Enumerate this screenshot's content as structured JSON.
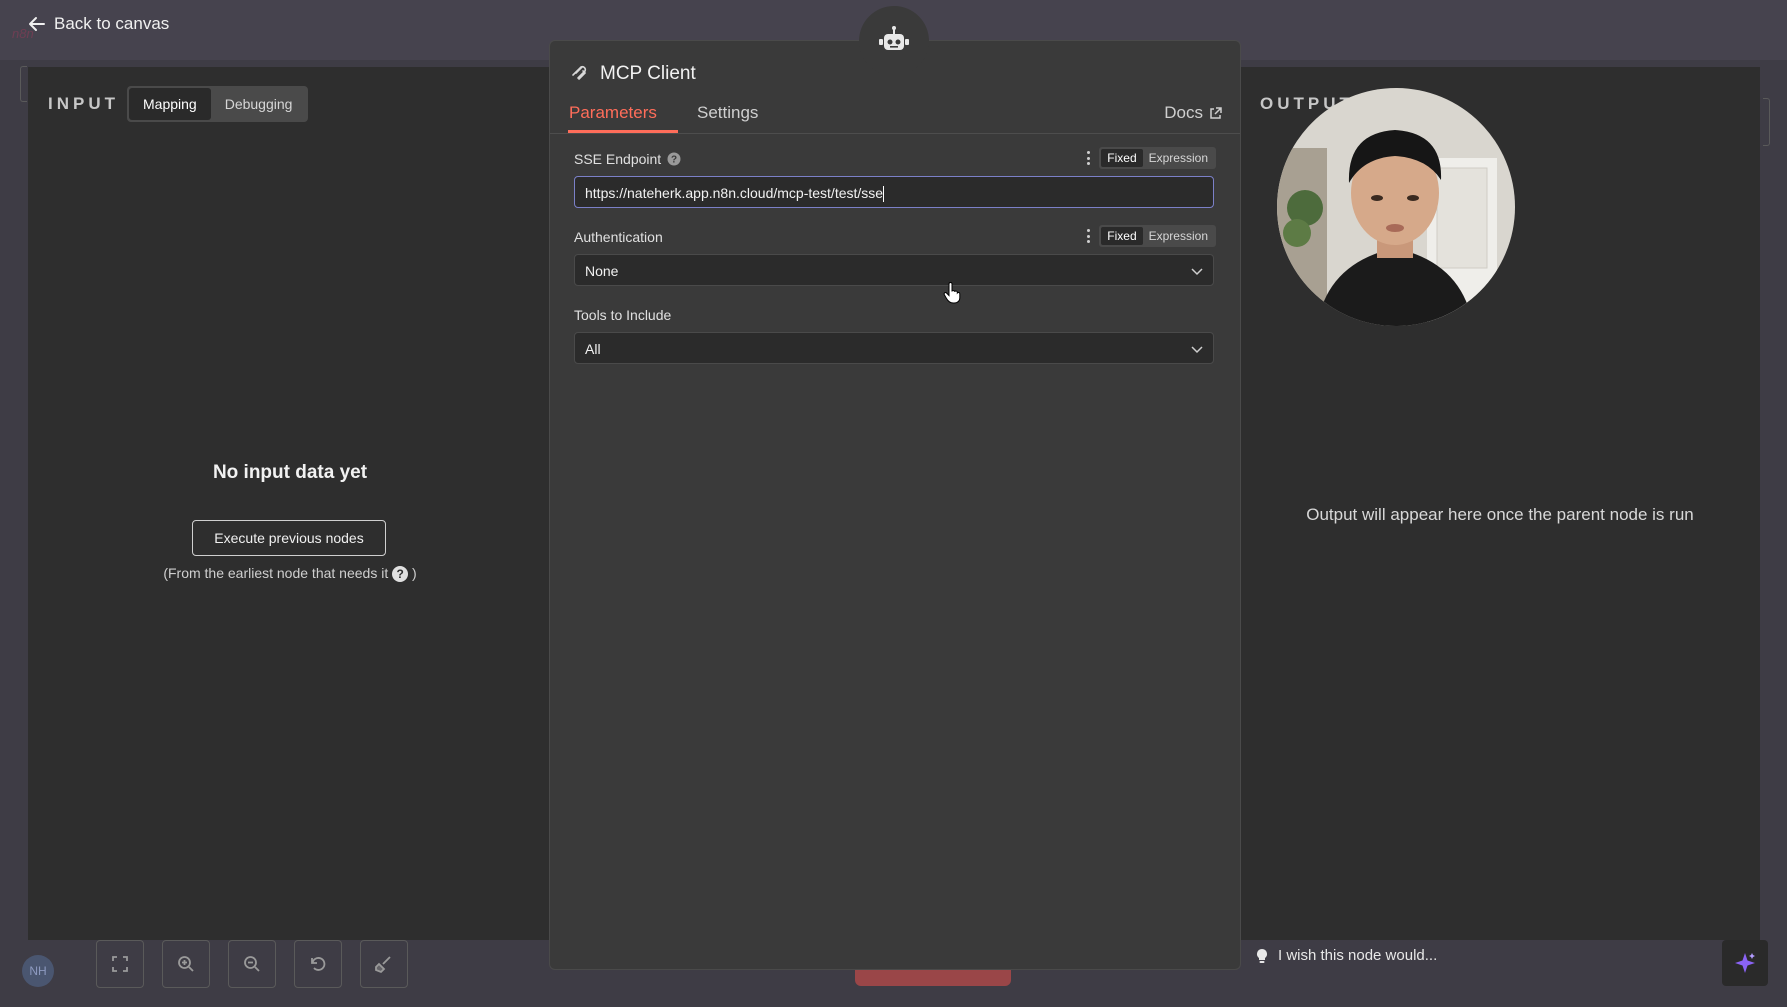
{
  "topbar": {
    "back_label": "Back to canvas"
  },
  "input_panel": {
    "label": "INPUT",
    "tabs": [
      {
        "label": "Mapping",
        "active": true
      },
      {
        "label": "Debugging",
        "active": false
      }
    ],
    "empty_title": "No input data yet",
    "execute_label": "Execute previous nodes",
    "note_before": "(From the earliest node that needs it",
    "note_after": ")",
    "help_glyph": "?"
  },
  "node": {
    "title": "MCP Client",
    "tabs": [
      {
        "label": "Parameters",
        "active": true
      },
      {
        "label": "Settings",
        "active": false
      }
    ],
    "docs_label": "Docs",
    "fields": [
      {
        "label": "SSE Endpoint",
        "value": "https://nateherk.app.n8n.cloud/mcp-test/test/sse",
        "has_help": true,
        "mode_fixed": "Fixed",
        "mode_expression": "Expression"
      },
      {
        "label": "Authentication",
        "value": "None",
        "mode_fixed": "Fixed",
        "mode_expression": "Expression"
      },
      {
        "label": "Tools to Include",
        "value": "All"
      }
    ]
  },
  "output_panel": {
    "label": "OUTPUT",
    "message": "Output will appear here once the parent node is run",
    "wish_label": "I wish this node would..."
  },
  "footer": {
    "avatar_initials": "NH"
  },
  "colors": {
    "accent": "#ff6d5a",
    "panel_bg": "#2e2e2e",
    "ndv_bg": "#3a3a3a",
    "page_bg": "#3e3c45"
  }
}
